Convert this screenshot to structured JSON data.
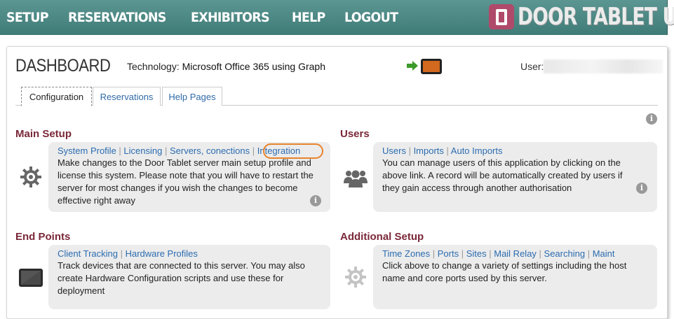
{
  "nav": {
    "items": [
      "SETUP",
      "RESERVATIONS",
      "EXHIBITORS",
      "HELP",
      "LOGOUT"
    ],
    "brand": "DOOR TABLET UI"
  },
  "header": {
    "title": "DASHBOARD",
    "technology_label": "Technology:",
    "technology_value": "Microsoft Office 365 using Graph",
    "user_label": "User:",
    "user_value": ""
  },
  "tabs": [
    "Configuration",
    "Reservations",
    "Help Pages"
  ],
  "info_icon_glyph": "i",
  "sections": {
    "main_setup": {
      "title": "Main Setup",
      "links": [
        "System Profile",
        "Licensing",
        "Servers, conections",
        "Integration"
      ],
      "description": "Make changes to the Door Tablet server main setup profile and license this system. Please note that you will have to restart the server for most changes if you wish the changes to become effective right away",
      "icon": "gear-icon"
    },
    "users": {
      "title": "Users",
      "links": [
        "Users",
        "Imports",
        "Auto Imports"
      ],
      "description": "You can manage users of this application by clicking on the above link. A record will be automatically created by users if they gain access through another authorisation",
      "icon": "users-icon"
    },
    "end_points": {
      "title": "End Points",
      "links": [
        "Client Tracking",
        "Hardware Profiles"
      ],
      "description": "Track devices that are connected to this server. You may also create Hardware Configuration scripts and use these for deployment",
      "icon": "tablet-device-icon"
    },
    "additional_setup": {
      "title": "Additional Setup",
      "links": [
        "Time Zones",
        "Ports",
        "Sites",
        "Mail Relay",
        "Searching",
        "Maint"
      ],
      "description": "Click above to change a variety of settings including the host name and core ports used by this server.",
      "icon": "cog-icon"
    }
  },
  "colors": {
    "nav_bg": "#4a8783",
    "section_title": "#7a2838",
    "link": "#2b6cb0",
    "card_bg": "#ececec",
    "highlight_ring": "#e8832a"
  }
}
